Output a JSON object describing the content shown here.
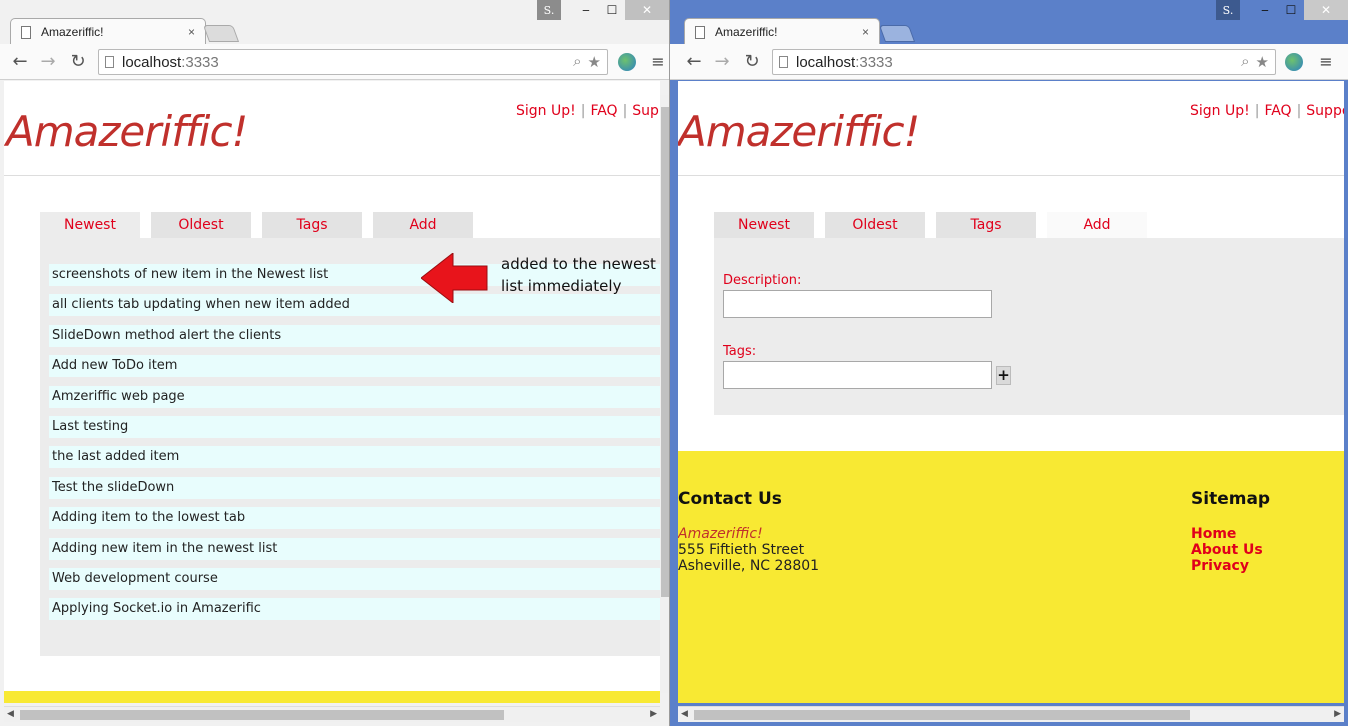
{
  "left_window": {
    "user_badge": "S.",
    "controls": {
      "minimize": "‒",
      "maximize": "☐",
      "close": "✕"
    },
    "tab_title": "Amazeriffic!",
    "tab_close": "×",
    "url_host": "localhost",
    "url_port": ":3333",
    "site": {
      "logo": "Amazeriffic!",
      "links": [
        "Sign Up!",
        "FAQ",
        "Supp"
      ],
      "link_sep": "|",
      "tabs": [
        "Newest",
        "Oldest",
        "Tags",
        "Add"
      ],
      "active_tab": "Newest",
      "todos": [
        "screenshots of new item in the Newest list",
        "all clients tab updating when new item added",
        "SlideDown method alert the clients",
        "Add new ToDo item",
        "Amzeriffic web page",
        "Last testing",
        "the last added item",
        "Test the slideDown",
        "Adding item to the lowest tab",
        "Adding new item in the newest list",
        "Web development course",
        "Applying Socket.io in Amazerific"
      ]
    },
    "annotation": {
      "line1": "added to the newest",
      "line2": "list immediately",
      "arrow_color": "#e8141b"
    }
  },
  "right_window": {
    "user_badge": "S.",
    "controls": {
      "minimize": "‒",
      "maximize": "☐",
      "close": "✕"
    },
    "tab_title": "Amazeriffic!",
    "tab_close": "×",
    "url_host": "localhost",
    "url_port": ":3333",
    "site": {
      "logo": "Amazeriffic!",
      "links": [
        "Sign Up!",
        "FAQ",
        "Suppo"
      ],
      "link_sep": "|",
      "tabs": [
        "Newest",
        "Oldest",
        "Tags",
        "Add"
      ],
      "active_tab": "Add",
      "form": {
        "description_label": "Description:",
        "description_value": "",
        "tags_label": "Tags:",
        "tags_value": "",
        "plus_label": "+"
      },
      "footer": {
        "contact_heading": "Contact Us",
        "brand": "Amazeriffic!",
        "address_line1": "555 Fiftieth Street",
        "address_line2": "Asheville, NC 28801",
        "sitemap_heading": "Sitemap",
        "sitemap_links": [
          "Home",
          "About Us",
          "Privacy"
        ]
      }
    }
  },
  "colors": {
    "accent_red": "#e0001b",
    "logo_red": "#c0302c",
    "footer_yellow": "#f8e933",
    "todo_bg": "#e8fdfd",
    "chrome_blue": "#5b80c9"
  },
  "icons": [
    "back-icon",
    "forward-icon",
    "reload-icon",
    "page-icon",
    "zoom-icon",
    "star-icon",
    "globe-icon",
    "menu-icon"
  ]
}
